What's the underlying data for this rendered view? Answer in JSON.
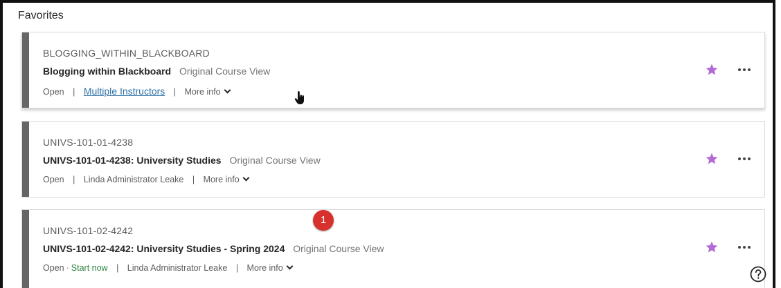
{
  "section": {
    "title": "Favorites"
  },
  "courses": [
    {
      "id": "BLOGGING_WITHIN_BLACKBOARD",
      "name": "Blogging within Blackboard",
      "view": "Original Course View",
      "status": "Open",
      "start": "",
      "instructor": "Multiple Instructors",
      "more": "More info"
    },
    {
      "id": "UNIVS-101-01-4238",
      "name": "UNIVS-101-01-4238: University Studies",
      "view": "Original Course View",
      "status": "Open",
      "start": "",
      "instructor": "Linda Administrator Leake",
      "more": "More info"
    },
    {
      "id": "UNIVS-101-02-4242",
      "name": "UNIVS-101-02-4242: University Studies - Spring 2024",
      "view": "Original Course View",
      "status": "Open",
      "start": "Start now",
      "instructor": "Linda Administrator Leake",
      "more": "More info"
    }
  ],
  "annotation": {
    "badge": "1"
  },
  "colors": {
    "star": "#b36ad6",
    "stripe": "#666666",
    "link": "#2f72a6",
    "start": "#2e8540",
    "badge": "#d6312d"
  },
  "icons": {
    "favorite": "star-icon",
    "menu": "more-options-icon",
    "help": "help-icon",
    "cursor": "hand-cursor-icon"
  }
}
